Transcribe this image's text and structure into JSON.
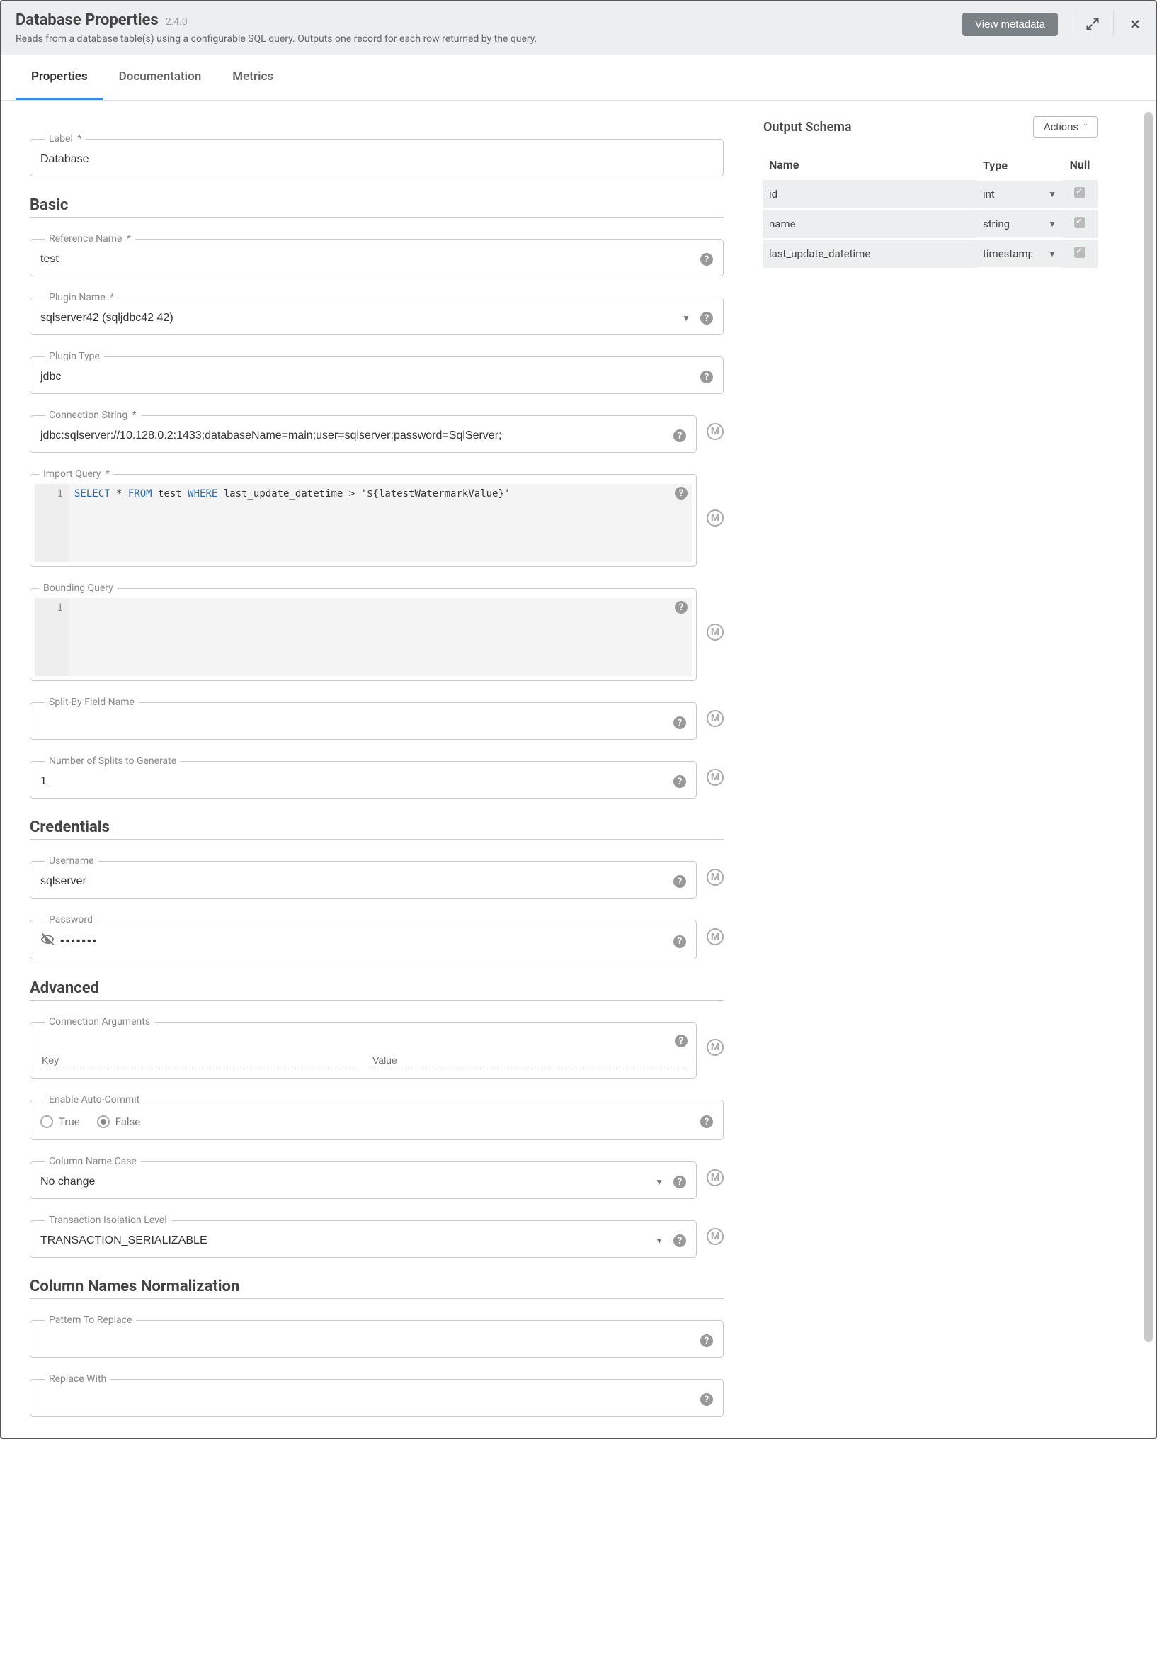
{
  "header": {
    "title": "Database Properties",
    "version": "2.4.0",
    "description": "Reads from a database table(s) using a configurable SQL query. Outputs one record for each row returned by the query.",
    "view_metadata": "View metadata"
  },
  "tabs": {
    "properties": "Properties",
    "documentation": "Documentation",
    "metrics": "Metrics"
  },
  "labels": {
    "label": "Label",
    "basic": "Basic",
    "reference_name": "Reference Name",
    "plugin_name": "Plugin Name",
    "plugin_type": "Plugin Type",
    "connection_string": "Connection String",
    "import_query": "Import Query",
    "bounding_query": "Bounding Query",
    "splitby": "Split-By Field Name",
    "num_splits": "Number of Splits to Generate",
    "credentials": "Credentials",
    "username": "Username",
    "password": "Password",
    "advanced": "Advanced",
    "conn_args": "Connection Arguments",
    "key": "Key",
    "value": "Value",
    "auto_commit": "Enable Auto-Commit",
    "true": "True",
    "false": "False",
    "col_case": "Column Name Case",
    "txn_iso": "Transaction Isolation Level",
    "col_norm": "Column Names Normalization",
    "pattern": "Pattern To Replace",
    "replace_with": "Replace With",
    "asterisk": "*"
  },
  "values": {
    "label": "Database",
    "reference_name": "test",
    "plugin_name": "sqlserver42 (sqljdbc42 42)",
    "plugin_type": "jdbc",
    "connection_string": "jdbc:sqlserver://10.128.0.2:1433;databaseName=main;user=sqlserver;password=SqlServer;",
    "import_query_line1": "1",
    "import_query_plain_before": " * ",
    "import_query_plain_mid": " test ",
    "import_query_plain_after": " last_update_datetime > '${latestWatermarkValue}'",
    "kw_select": "SELECT",
    "kw_from": "FROM",
    "kw_where": "WHERE",
    "bounding_query_line1": "1",
    "num_splits": "1",
    "username": "sqlserver",
    "password": "•••••••",
    "col_case": "No change",
    "txn_iso": "TRANSACTION_SERIALIZABLE"
  },
  "schema": {
    "title": "Output Schema",
    "actions": "Actions",
    "cols": {
      "name": "Name",
      "type": "Type",
      "null": "Null"
    },
    "rows": [
      {
        "name": "id",
        "type": "int"
      },
      {
        "name": "name",
        "type": "string"
      },
      {
        "name": "last_update_datetime",
        "type": "timestamp"
      }
    ]
  }
}
